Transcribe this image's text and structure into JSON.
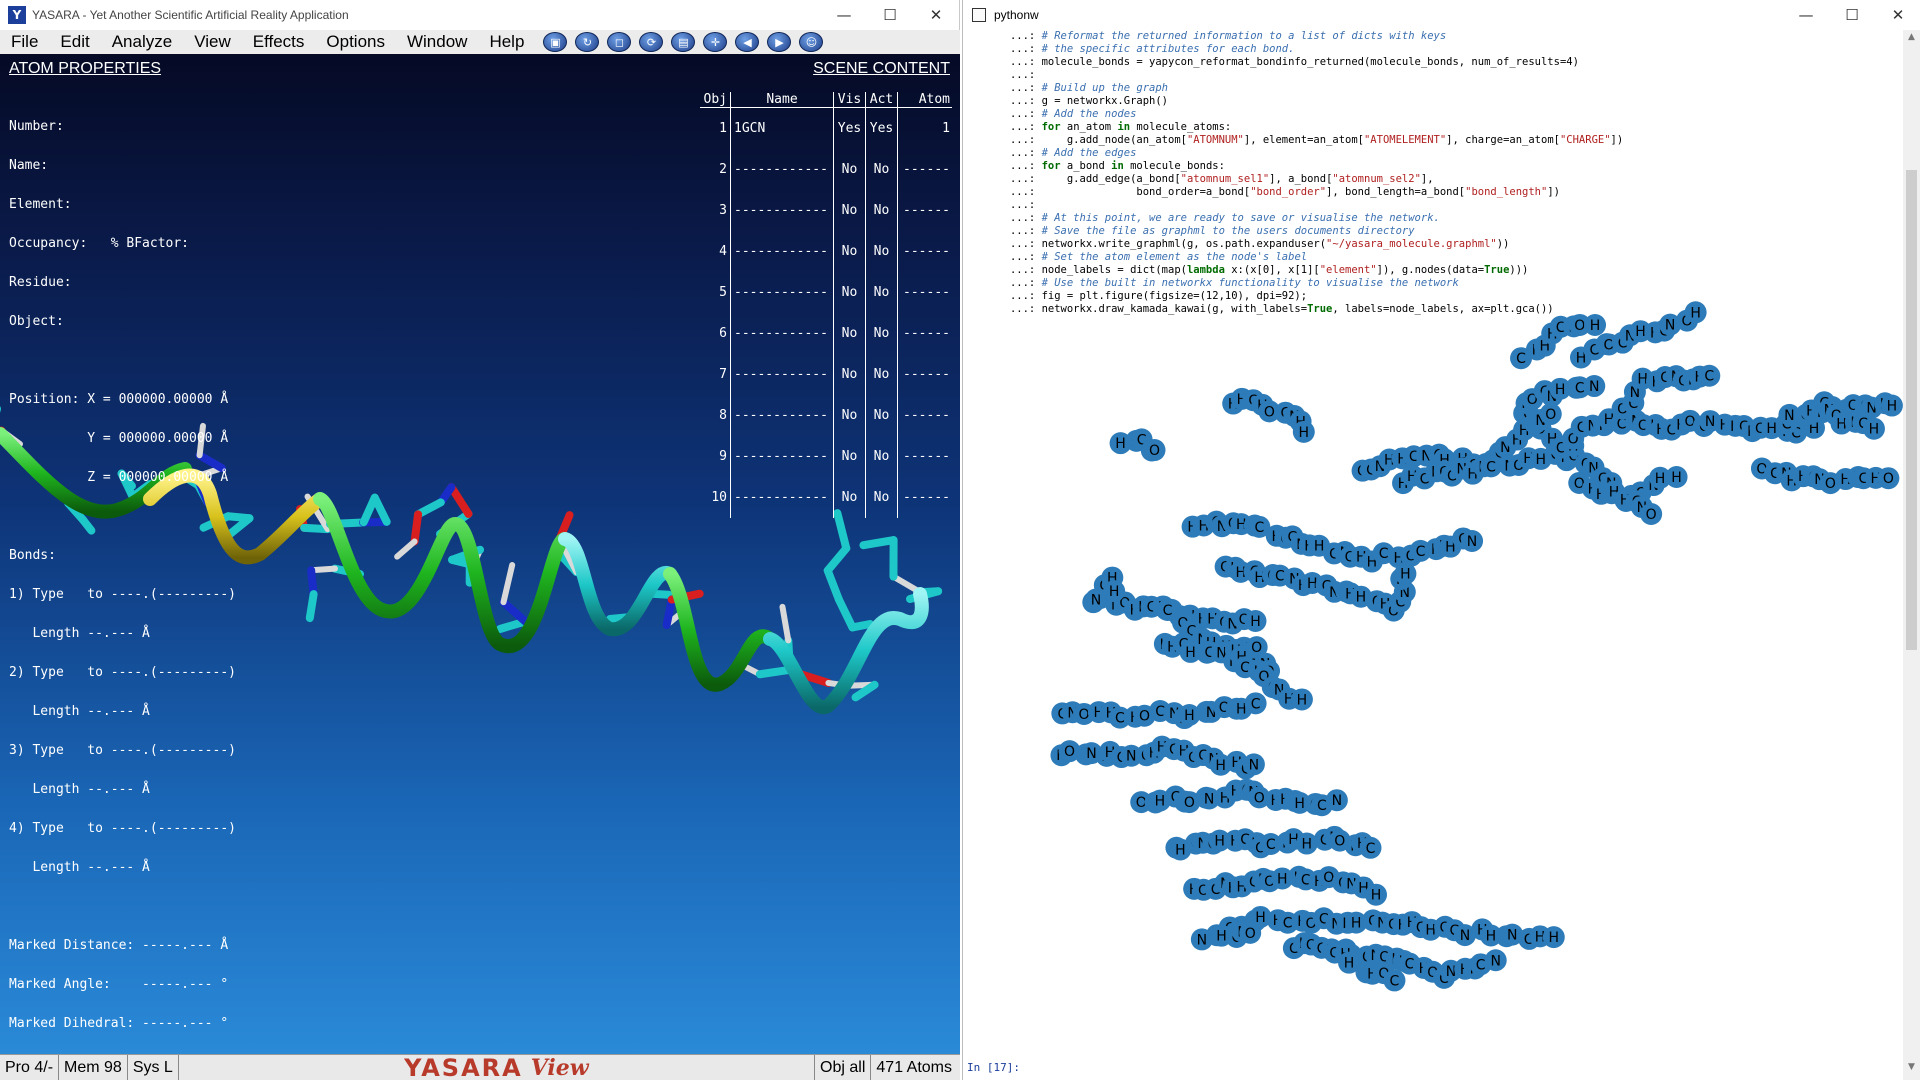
{
  "yasara": {
    "title": "YASARA - Yet Another Scientific Artificial Reality Application",
    "window_controls": [
      "—",
      "☐",
      "✕"
    ],
    "menus": [
      {
        "label": "File"
      },
      {
        "label": "Edit"
      },
      {
        "label": "Analyze"
      },
      {
        "label": "View"
      },
      {
        "label": "Effects"
      },
      {
        "label": "Options"
      },
      {
        "label": "Window"
      },
      {
        "label": "Help"
      }
    ],
    "toolbar_icons": [
      "select-icon",
      "rotate-icon",
      "cube-icon",
      "refresh-icon",
      "box-icon",
      "center-icon",
      "rewind-icon",
      "forward-icon",
      "face-icon"
    ],
    "atom_properties": {
      "title": "ATOM PROPERTIES",
      "lines": [
        "Number:",
        "Name:",
        "Element:",
        "Occupancy:   % BFactor:",
        "Residue:",
        "Object:",
        "",
        "Position: X = 000000.00000 Å",
        "          Y = 000000.00000 Å",
        "          Z = 000000.00000 Å",
        "",
        "Bonds:",
        "1) Type   to ----.(---------)",
        "   Length --.--- Å",
        "2) Type   to ----.(---------)",
        "   Length --.--- Å",
        "3) Type   to ----.(---------)",
        "   Length --.--- Å",
        "4) Type   to ----.(---------)",
        "   Length --.--- Å",
        "",
        "Marked Distance: -----.--- Å",
        "Marked Angle:    -----.--- °",
        "Marked Dihedral: -----.--- °"
      ]
    },
    "scene_content": {
      "title": "SCENE CONTENT",
      "headers": [
        "Obj",
        "Name",
        "Vis",
        "Act",
        "Atom"
      ],
      "rows": [
        {
          "obj": "1",
          "name": "1GCN",
          "vis": "Yes",
          "act": "Yes",
          "atom": "1"
        },
        {
          "obj": "2",
          "name": "------------",
          "vis": "No",
          "act": "No",
          "atom": "------"
        },
        {
          "obj": "3",
          "name": "------------",
          "vis": "No",
          "act": "No",
          "atom": "------"
        },
        {
          "obj": "4",
          "name": "------------",
          "vis": "No",
          "act": "No",
          "atom": "------"
        },
        {
          "obj": "5",
          "name": "------------",
          "vis": "No",
          "act": "No",
          "atom": "------"
        },
        {
          "obj": "6",
          "name": "------------",
          "vis": "No",
          "act": "No",
          "atom": "------"
        },
        {
          "obj": "7",
          "name": "------------",
          "vis": "No",
          "act": "No",
          "atom": "------"
        },
        {
          "obj": "8",
          "name": "------------",
          "vis": "No",
          "act": "No",
          "atom": "------"
        },
        {
          "obj": "9",
          "name": "------------",
          "vis": "No",
          "act": "No",
          "atom": "------"
        },
        {
          "obj": "10",
          "name": "------------",
          "vis": "No",
          "act": "No",
          "atom": "------"
        }
      ]
    },
    "status": {
      "pro": "Pro 4/-",
      "mem": "Mem 98",
      "sys": "Sys  L",
      "logo_left": "YASARA",
      "logo_right": "View",
      "obj": "Obj  all",
      "atoms": "471 Atoms"
    },
    "colors": {
      "ribbon_green": "#1fb51f",
      "ribbon_yellow": "#d8c21c",
      "carbon": "#1ec8c8",
      "nitrogen": "#1a2cc8",
      "oxygen": "#d81e1e",
      "hydrogen": "#d9d9d9"
    }
  },
  "pythonw": {
    "title": "pythonw",
    "window_controls": [
      "—",
      "☐",
      "✕"
    ],
    "code_lines": [
      [
        [
          "p",
          "   ...: "
        ],
        [
          "c",
          "# Reformat the returned information to a list of dicts with keys"
        ]
      ],
      [
        [
          "p",
          "   ...: "
        ],
        [
          "c",
          "# the specific attributes for each bond."
        ]
      ],
      [
        [
          "p",
          "   ...: molecule_bonds = yapycon_reformat_bondinfo_returned(molecule_bonds, num_of_results=4)"
        ]
      ],
      [
        [
          "p",
          "   ...: "
        ]
      ],
      [
        [
          "p",
          "   ...: "
        ],
        [
          "c",
          "# Build up the graph"
        ]
      ],
      [
        [
          "p",
          "   ...: g = networkx.Graph()"
        ]
      ],
      [
        [
          "p",
          "   ...: "
        ],
        [
          "c",
          "# Add the nodes"
        ]
      ],
      [
        [
          "p",
          "   ...: "
        ],
        [
          "k",
          "for"
        ],
        [
          "p",
          " an_atom "
        ],
        [
          "k",
          "in"
        ],
        [
          "p",
          " molecule_atoms:"
        ]
      ],
      [
        [
          "p",
          "   ...:     g.add_node(an_atom["
        ],
        [
          "s",
          "\"ATOMNUM\""
        ],
        [
          "p",
          "], element=an_atom["
        ],
        [
          "s",
          "\"ATOMELEMENT\""
        ],
        [
          "p",
          "], charge=an_atom["
        ],
        [
          "s",
          "\"CHARGE\""
        ],
        [
          "p",
          "])"
        ]
      ],
      [
        [
          "p",
          "   ...: "
        ],
        [
          "c",
          "# Add the edges"
        ]
      ],
      [
        [
          "p",
          "   ...: "
        ],
        [
          "k",
          "for"
        ],
        [
          "p",
          " a_bond "
        ],
        [
          "k",
          "in"
        ],
        [
          "p",
          " molecule_bonds:"
        ]
      ],
      [
        [
          "p",
          "   ...:     g.add_edge(a_bond["
        ],
        [
          "s",
          "\"atomnum_sel1\""
        ],
        [
          "p",
          "], a_bond["
        ],
        [
          "s",
          "\"atomnum_sel2\""
        ],
        [
          "p",
          "],"
        ]
      ],
      [
        [
          "p",
          "   ...:                bond_order=a_bond["
        ],
        [
          "s",
          "\"bond_order\""
        ],
        [
          "p",
          "], bond_length=a_bond["
        ],
        [
          "s",
          "\"bond_length\""
        ],
        [
          "p",
          "])"
        ]
      ],
      [
        [
          "p",
          "   ...: "
        ]
      ],
      [
        [
          "p",
          "   ...: "
        ],
        [
          "c",
          "# At this point, we are ready to save or visualise the network."
        ]
      ],
      [
        [
          "p",
          "   ...: "
        ],
        [
          "c",
          "# Save the file as graphml to the users documents directory"
        ]
      ],
      [
        [
          "p",
          "   ...: networkx.write_graphml(g, os.path.expanduser("
        ],
        [
          "s",
          "\"~/yasara_molecule.graphml\""
        ],
        [
          "p",
          "))"
        ]
      ],
      [
        [
          "p",
          "   ...: "
        ],
        [
          "c",
          "# Set the atom element as the node's label"
        ]
      ],
      [
        [
          "p",
          "   ...: node_labels = dict(map("
        ],
        [
          "k",
          "lambda"
        ],
        [
          "p",
          " x:(x[0], x[1]["
        ],
        [
          "s",
          "\"element\""
        ],
        [
          "p",
          "]), g.nodes(data="
        ],
        [
          "k",
          "True"
        ],
        [
          "p",
          ")))"
        ]
      ],
      [
        [
          "p",
          "   ...: "
        ],
        [
          "c",
          "# Use the built in networkx functionality to visualise the network"
        ]
      ],
      [
        [
          "p",
          "   ...: fig = plt.figure(figsize=(12,10), dpi=92);"
        ]
      ],
      [
        [
          "p",
          "   ...: networkx.draw_kamada_kawai(g, with_labels="
        ],
        [
          "k",
          "True"
        ],
        [
          "p",
          ", labels=node_labels, ax=plt.gca())"
        ]
      ]
    ],
    "graph_node_labels": [
      "H",
      "C",
      "N",
      "O",
      "H",
      "H",
      "C",
      "H",
      "O",
      "C",
      "N",
      "H"
    ],
    "node_color": "#2d7bb8",
    "prompt": "In [17]:"
  }
}
